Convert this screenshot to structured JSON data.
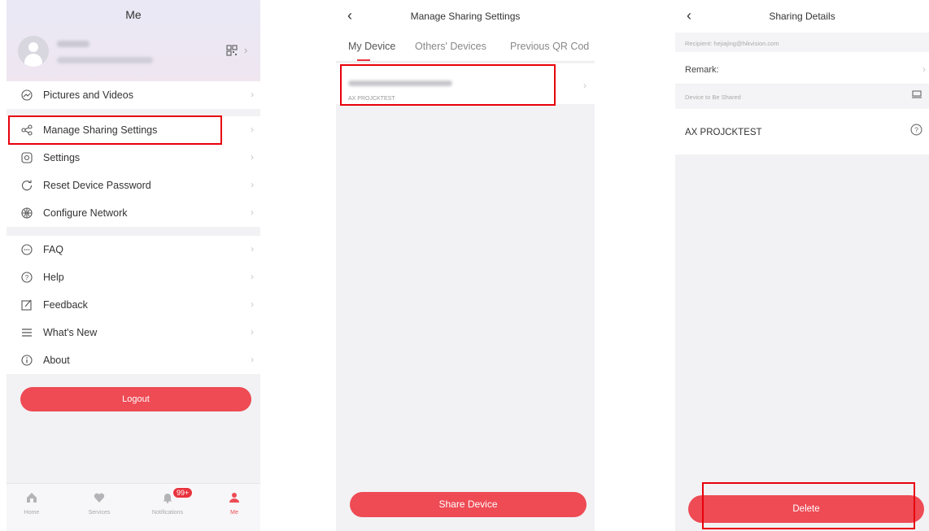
{
  "colors": {
    "accent": "#ee4b55",
    "highlight": "#e8000b"
  },
  "me_screen": {
    "title": "Me",
    "group1": [
      {
        "icon": "image-icon",
        "label": "Pictures and Videos"
      }
    ],
    "group2": [
      {
        "icon": "share-icon",
        "label": "Manage Sharing Settings"
      },
      {
        "icon": "gear-icon",
        "label": "Settings"
      },
      {
        "icon": "reset-icon",
        "label": "Reset Device Password"
      },
      {
        "icon": "network-icon",
        "label": "Configure Network"
      }
    ],
    "group3": [
      {
        "icon": "faq-icon",
        "label": "FAQ"
      },
      {
        "icon": "help-icon",
        "label": "Help"
      },
      {
        "icon": "feedback-icon",
        "label": "Feedback"
      },
      {
        "icon": "list-icon",
        "label": "What's New"
      },
      {
        "icon": "info-icon",
        "label": "About"
      }
    ],
    "logout_label": "Logout",
    "tabbar": {
      "home": "Home",
      "services": "Services",
      "notifications": "Notifications",
      "notifications_badge": "99+",
      "me": "Me"
    }
  },
  "sharing_screen": {
    "title": "Manage Sharing Settings",
    "tabs": [
      "My Device",
      "Others' Devices",
      "Previous QR Cod"
    ],
    "device_name": "AX PROJCKTEST",
    "share_button": "Share Device"
  },
  "details_screen": {
    "title": "Sharing Details",
    "recipient": "Recipient: hejiajing@hikvision.com",
    "remark_label": "Remark:",
    "section_label": "Device to Be Shared",
    "device_name": "AX PROJCKTEST",
    "delete_button": "Delete"
  }
}
